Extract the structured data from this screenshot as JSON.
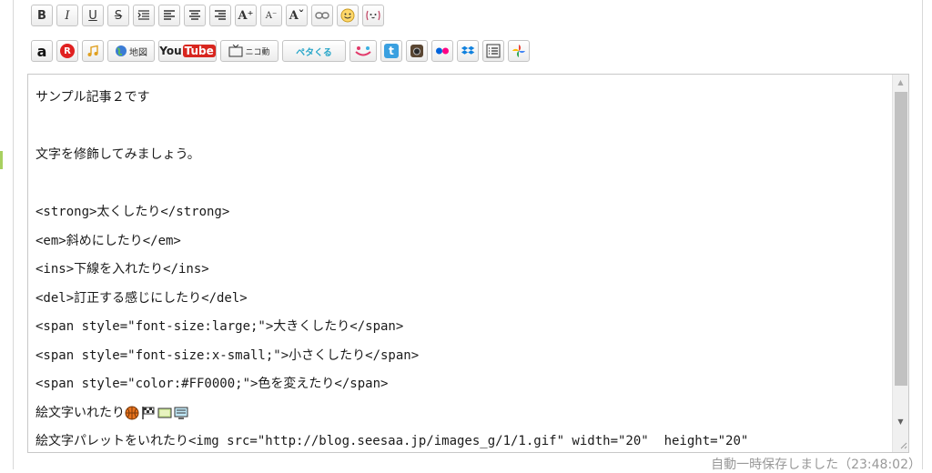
{
  "toolbar_format": {
    "bold": "B",
    "italic": "I",
    "underline": "U",
    "strike": "S",
    "font_size_up": "A⁺",
    "font_size_down": "A⁻",
    "font_color": "Aˇ"
  },
  "toolbar_insert": {
    "amazon": "a",
    "rakuten": "R",
    "map": "地図",
    "youtube_you": "You",
    "youtube_tube": "Tube",
    "nico": "ニコ動",
    "petakuru": "ペタくる"
  },
  "editor": {
    "lines": [
      "サンプル記事２です",
      "",
      "文字を修飾してみましょう。",
      "",
      "<strong>太くしたり</strong>",
      "<em>斜めにしたり</em>",
      "<ins>下線を入れたり</ins>",
      "<del>訂正する感じにしたり</del>",
      "<span style=\"font-size:large;\">大きくしたり</span>",
      "<span style=\"font-size:x-small;\">小さくしたり</span>",
      "<span style=\"color:#FF0000;\">色を変えたり</span>",
      "絵文字いれたり",
      "絵文字パレットをいれたり<img src=\"http://blog.seesaa.jp/images_g/1/1.gif\" width=\"20\"  height=\"20\""
    ],
    "emoji_icons": [
      "basketball-icon",
      "flag-icon",
      "tv-icon",
      "monitor-icon"
    ]
  },
  "status": {
    "autosave": "自動一時保存しました（23:48:02）"
  },
  "colors": {
    "accent_red": "#e02020",
    "youtube_red": "#d8261f",
    "twitter_blue": "#3aa0e0"
  }
}
